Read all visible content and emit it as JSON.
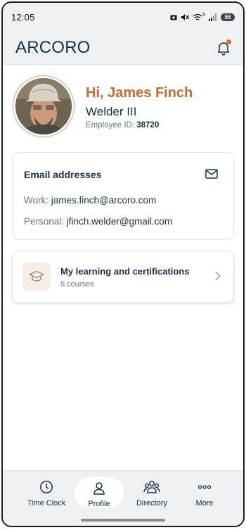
{
  "status_bar": {
    "time": "12:05",
    "signal_indicator": "5",
    "battery": "56"
  },
  "header": {
    "logo": "ARCORO",
    "notification_icon": "bell-icon"
  },
  "profile": {
    "greeting": "Hi, James Finch",
    "job_title": "Welder III",
    "employee_id_label": "Employee ID:",
    "employee_id": "38720"
  },
  "email_card": {
    "title": "Email addresses",
    "work_label": "Work:",
    "work_email": "james.finch@arcoro.com",
    "personal_label": "Personal:",
    "personal_email": "jfinch.welder@gmail.com"
  },
  "learning_card": {
    "title": "My learning and certifications",
    "subtitle": "5 courses"
  },
  "bottom_nav": {
    "items": [
      {
        "label": "Time Clock",
        "icon": "clock-icon"
      },
      {
        "label": "Profile",
        "icon": "person-icon",
        "active": true
      },
      {
        "label": "Directory",
        "icon": "people-icon"
      },
      {
        "label": "More",
        "icon": "dots-icon"
      }
    ]
  },
  "colors": {
    "brand_navy": "#183247",
    "accent_orange": "#c96a32",
    "notification_dot": "#e06b2a",
    "background_header": "#eef0f2"
  }
}
